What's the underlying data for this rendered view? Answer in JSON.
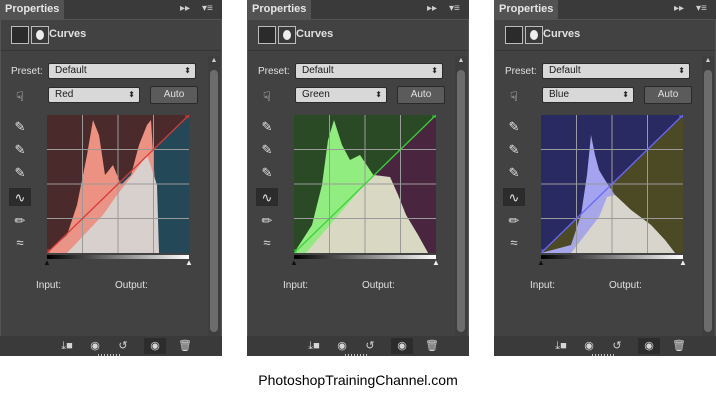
{
  "panels": [
    {
      "tab_title": "Properties",
      "adjustment_title": "Curves",
      "preset_label": "Preset:",
      "preset_value": "Default",
      "channel_value": "Red",
      "auto_label": "Auto",
      "input_label": "Input:",
      "output_label": "Output:",
      "overlay_color": "#ff9c8c",
      "shadow_tint": "#4a2a2a",
      "highlight_tint": "#234858",
      "curve_color": "#d93a3a"
    },
    {
      "tab_title": "Properties",
      "adjustment_title": "Curves",
      "preset_label": "Preset:",
      "preset_value": "Default",
      "channel_value": "Green",
      "auto_label": "Auto",
      "input_label": "Input:",
      "output_label": "Output:",
      "overlay_color": "#9cff8a",
      "shadow_tint": "#2a4a25",
      "highlight_tint": "#4a2540",
      "curve_color": "#3bd13b"
    },
    {
      "tab_title": "Properties",
      "adjustment_title": "Curves",
      "preset_label": "Preset:",
      "preset_value": "Default",
      "channel_value": "Blue",
      "auto_label": "Auto",
      "input_label": "Input:",
      "output_label": "Output:",
      "overlay_color": "#b0b0ff",
      "shadow_tint": "#2a2a63",
      "highlight_tint": "#4c4a25",
      "curve_color": "#6868ff"
    }
  ],
  "caption": "PhotoshopTrainingChannel.com",
  "icons": {
    "panel_menu": "panel-menu-icon",
    "collapse": "double-arrow-icon",
    "curves_adjust": "curves-icon",
    "mask": "mask-icon",
    "on_image": "hand-adjust-icon",
    "eyedropper_black": "eyedropper-black-icon",
    "eyedropper_gray": "eyedropper-gray-icon",
    "eyedropper_white": "eyedropper-white-icon",
    "curve_tool": "curve-tool-icon",
    "pencil": "pencil-icon",
    "smooth": "smooth-icon",
    "clip": "clip-to-layer-icon",
    "view_prev": "view-previous-icon",
    "reset": "reset-icon",
    "visibility": "eye-icon",
    "delete": "trash-icon"
  }
}
